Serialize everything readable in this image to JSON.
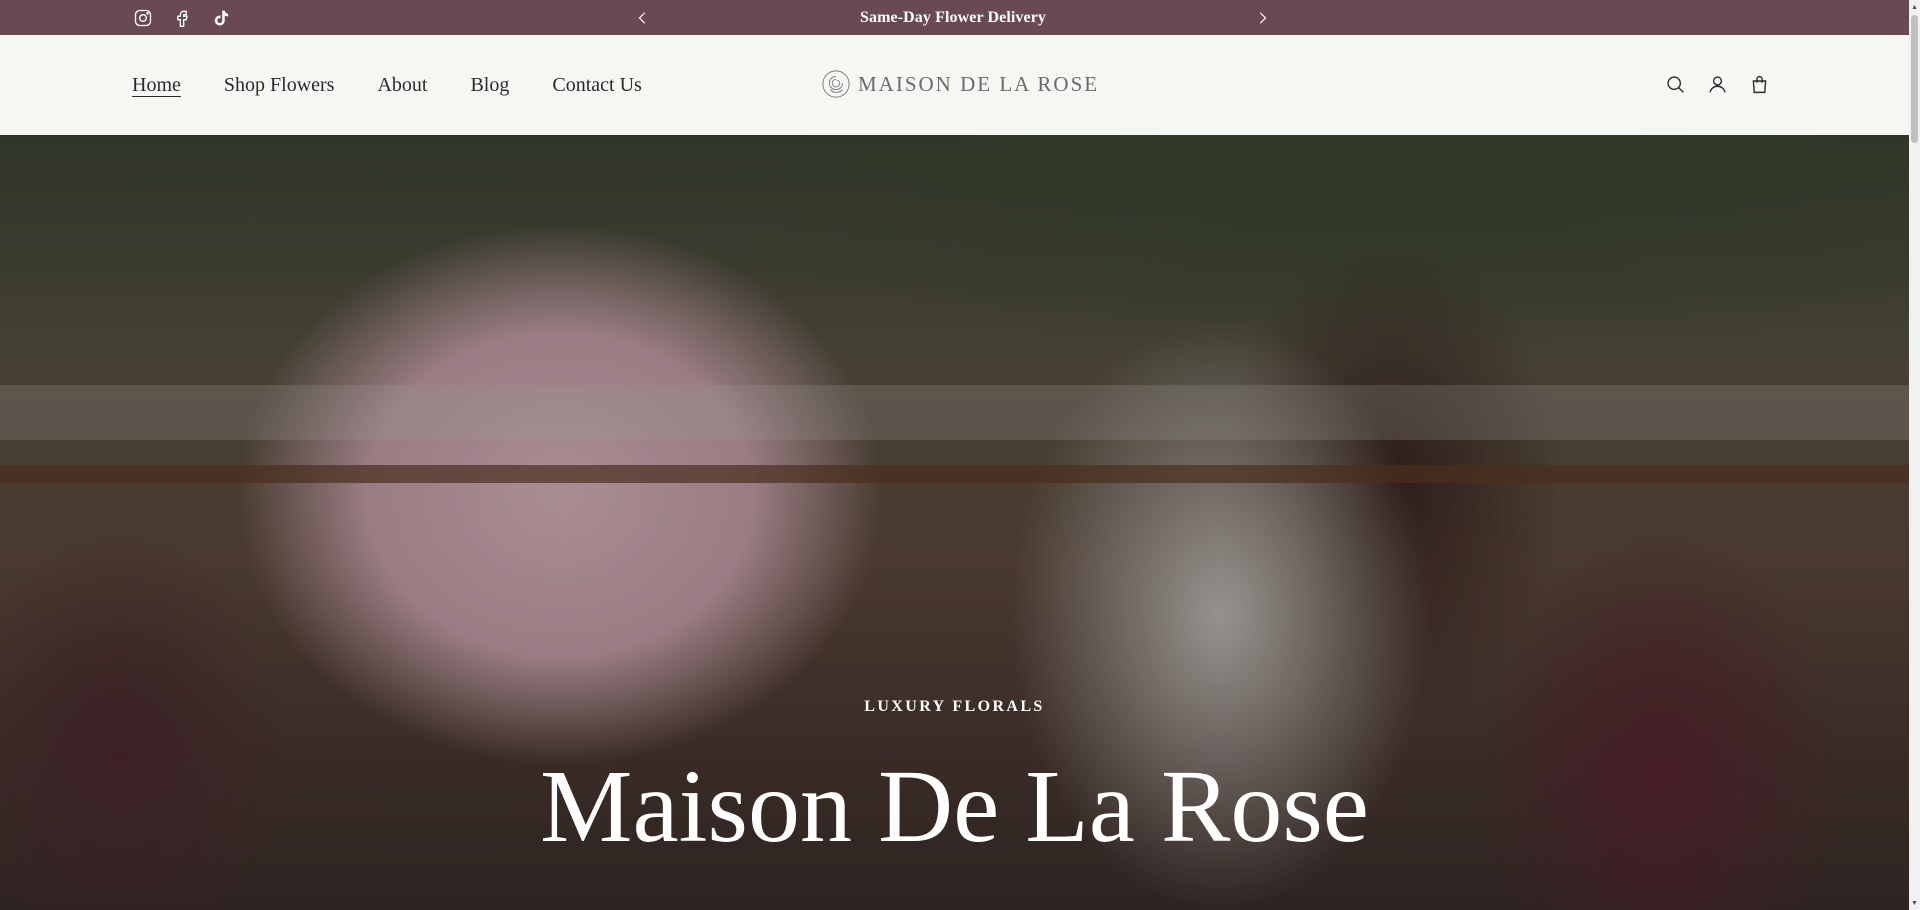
{
  "announcement": {
    "text": "Same-Day Flower Delivery",
    "prev_icon": "chevron-left-icon",
    "next_icon": "chevron-right-icon",
    "background": "#6a4a52"
  },
  "social": [
    {
      "name": "instagram-icon"
    },
    {
      "name": "facebook-icon"
    },
    {
      "name": "tiktok-icon"
    }
  ],
  "nav": {
    "items": [
      {
        "label": "Home",
        "active": true
      },
      {
        "label": "Shop Flowers"
      },
      {
        "label": "About"
      },
      {
        "label": "Blog"
      },
      {
        "label": "Contact Us"
      }
    ]
  },
  "logo": {
    "text": "MAISON DE LA ROSE",
    "icon": "rose-logo-icon"
  },
  "header_icons": [
    "search-icon",
    "account-icon",
    "cart-icon"
  ],
  "hero": {
    "eyebrow": "LUXURY FLORALS",
    "title": "Maison De La Rose"
  },
  "colors": {
    "header_bg": "#f5f8f2",
    "announcement_bg": "#6a4a52",
    "hero_text": "#ffffff"
  }
}
